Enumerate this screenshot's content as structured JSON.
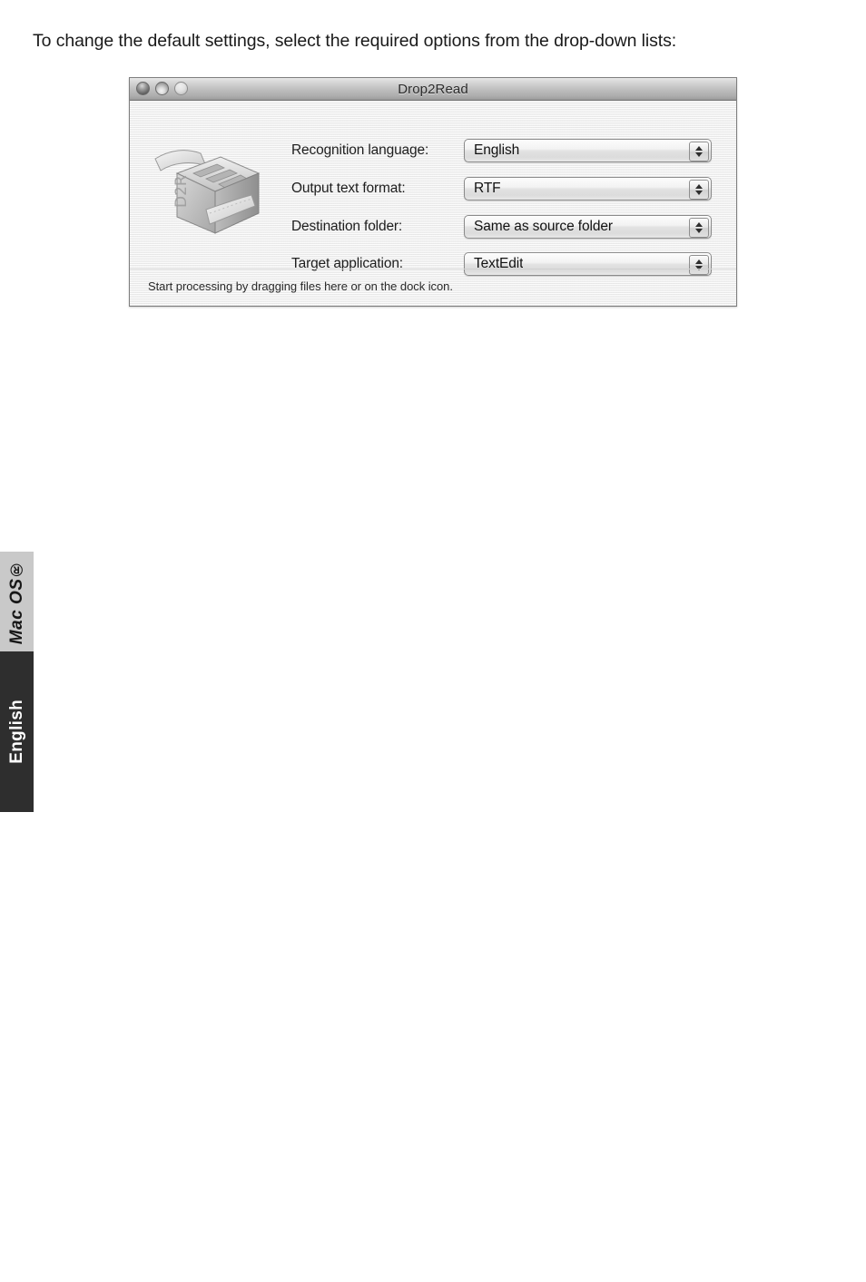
{
  "document": {
    "paragraph": "To change the default settings, select the required options from the drop-down lists:"
  },
  "window": {
    "title": "Drop2Read",
    "traffic_lights": {
      "close_label": "close",
      "minimize_label": "minimize",
      "zoom_label": "zoom"
    },
    "app_icon_name": "drop2read-scanner-icon",
    "app_icon_caption": "D2R",
    "settings": [
      {
        "label": "Recognition language:",
        "value": "English"
      },
      {
        "label": "Output text format:",
        "value": "RTF"
      },
      {
        "label": "Destination folder:",
        "value": "Same as source folder"
      },
      {
        "label": "Target application:",
        "value": "TextEdit"
      }
    ],
    "status_text": "Start processing by dragging files here or on the dock icon."
  },
  "side_tabs": [
    {
      "label": "Mac OS®",
      "state": "inactive"
    },
    {
      "label": "English",
      "state": "active"
    }
  ],
  "colors": {
    "page_background": "#ffffff",
    "window_body": "#ececec",
    "titlebar_base": "#bdbdbd",
    "tab_inactive": "#c9c9c9",
    "tab_active": "#2e2e2e",
    "text_primary": "#1a1a1a"
  }
}
